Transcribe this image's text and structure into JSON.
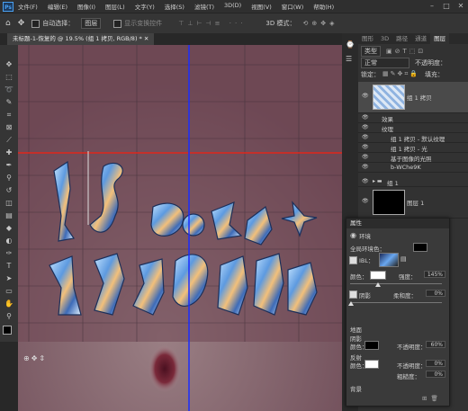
{
  "app": {
    "logo": "Ps"
  },
  "menu": [
    "文件(F)",
    "编辑(E)",
    "图像(I)",
    "图层(L)",
    "文字(Y)",
    "选择(S)",
    "滤镜(T)",
    "3D(D)",
    "视图(V)",
    "窗口(W)",
    "帮助(H)"
  ],
  "options": {
    "auto_select_label": "自动选择：",
    "auto_select_value": "图层",
    "transform_label": "显示变换控件",
    "mode3d_label": "3D 模式："
  },
  "document": {
    "tab_title": "未标题-1-恢复的 @ 19.5% (组 1 拷贝, RGB/8) *"
  },
  "layers_panel": {
    "tabs": [
      "图形",
      "3D",
      "路径",
      "通道",
      "图层"
    ],
    "filter": "类型",
    "blend_mode": "正常",
    "opacity_label": "不透明度：",
    "lock_label": "锁定：",
    "fill_label": "填充：",
    "layers": [
      {
        "name": "组 1 拷贝",
        "indent": 0
      },
      {
        "name": "效果",
        "indent": 1
      },
      {
        "name": "纹理",
        "indent": 1
      },
      {
        "name": "组 1 拷贝 - 默认纹理",
        "indent": 2
      },
      {
        "name": "组 1 拷贝 - 光",
        "indent": 2
      },
      {
        "name": "基于图像的光照",
        "indent": 2
      },
      {
        "name": "b-WChe9K",
        "indent": 2
      },
      {
        "name": "组 1",
        "indent": 0
      },
      {
        "name": "图层 1",
        "indent": 0
      }
    ]
  },
  "properties": {
    "title": "属性",
    "tab": "环境",
    "global_color_label": "全局环境色：",
    "ibl_label": "IBL：",
    "color_label": "颜色：",
    "intensity_label": "强度：",
    "intensity_value": "145%",
    "intensity_fraction": 0.3,
    "shadow_label": "阴影",
    "softness_label": "柔和度：",
    "softness_value": "0%",
    "ground_label": "地面",
    "shadow2_label": "阴影",
    "opacity_label": "不透明度：",
    "opacity_value": "60%",
    "reflection_label": "反射",
    "reflection_opacity_label": "不透明度：",
    "reflection_opacity_value": "0%",
    "roughness_label": "粗糙度：",
    "roughness_value": "0%",
    "background_label": "背景"
  },
  "colors": {
    "accent": "#1473e6",
    "canvas_bg": "#6e4c57",
    "guide_red": "#e0261a",
    "guide_blue": "#1a2cff"
  }
}
